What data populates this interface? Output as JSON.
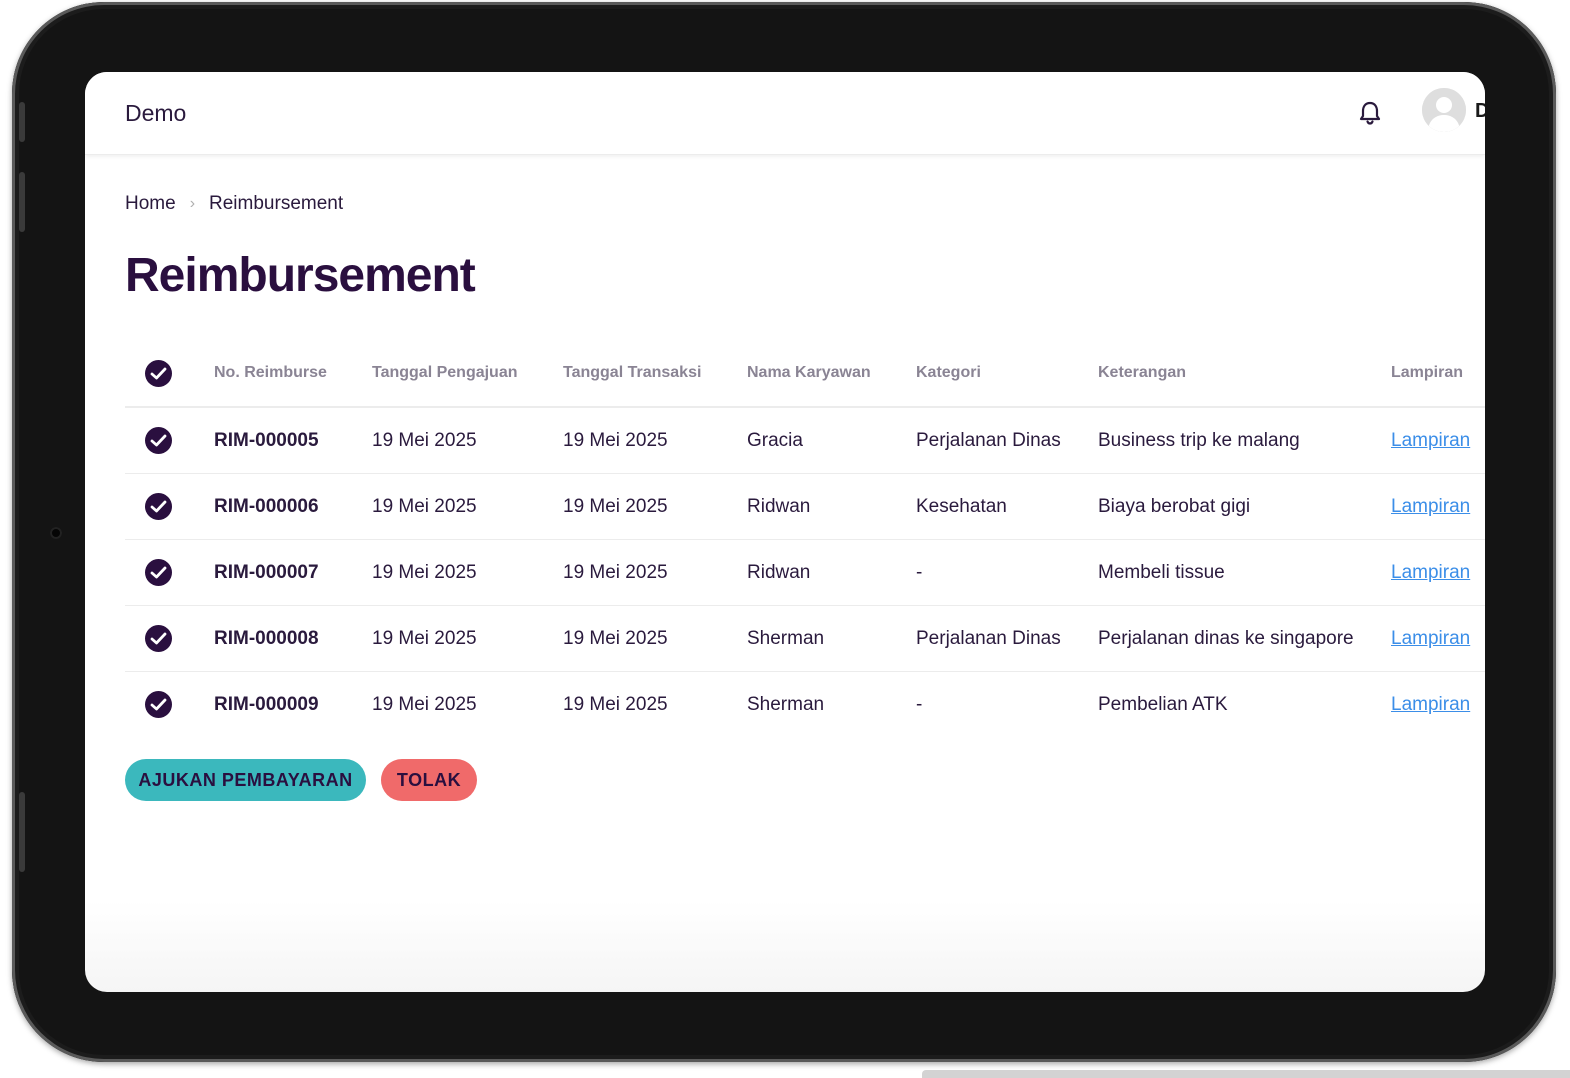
{
  "app": {
    "title": "Demo",
    "user_initial": "D"
  },
  "icons": {
    "notification": "bell-icon",
    "user": "user-avatar-icon",
    "breadcrumb_separator": "chevron-right-icon",
    "checkbox": "check-icon"
  },
  "colors": {
    "primary": "#2a0f3f",
    "submit_button": "#3bb8bd",
    "reject_button": "#f06a6a",
    "link": "#3b8ee8"
  },
  "breadcrumb": {
    "home": "Home",
    "current": "Reimbursement"
  },
  "page": {
    "title": "Reimbursement"
  },
  "table": {
    "headers": [
      "No. Reimburse",
      "Tanggal Pengajuan",
      "Tanggal Transaksi",
      "Nama Karyawan",
      "Kategori",
      "Keterangan",
      "Lampiran"
    ],
    "all_checked": true,
    "rows": [
      {
        "checked": true,
        "no": "RIM-000005",
        "tanggal_pengajuan": "19 Mei 2025",
        "tanggal_transaksi": "19 Mei 2025",
        "nama": "Gracia",
        "kategori": "Perjalanan Dinas",
        "keterangan": "Business trip ke malang",
        "lampiran": "Lampiran"
      },
      {
        "checked": true,
        "no": "RIM-000006",
        "tanggal_pengajuan": "19 Mei 2025",
        "tanggal_transaksi": "19 Mei 2025",
        "nama": "Ridwan",
        "kategori": "Kesehatan",
        "keterangan": "Biaya berobat gigi",
        "lampiran": "Lampiran"
      },
      {
        "checked": true,
        "no": "RIM-000007",
        "tanggal_pengajuan": "19 Mei 2025",
        "tanggal_transaksi": "19 Mei 2025",
        "nama": "Ridwan",
        "kategori": "-",
        "keterangan": "Membeli tissue",
        "lampiran": "Lampiran"
      },
      {
        "checked": true,
        "no": "RIM-000008",
        "tanggal_pengajuan": "19 Mei 2025",
        "tanggal_transaksi": "19 Mei 2025",
        "nama": "Sherman",
        "kategori": "Perjalanan Dinas",
        "keterangan": "Perjalanan dinas ke singapore",
        "lampiran": "Lampiran"
      },
      {
        "checked": true,
        "no": "RIM-000009",
        "tanggal_pengajuan": "19 Mei 2025",
        "tanggal_transaksi": "19 Mei 2025",
        "nama": "Sherman",
        "kategori": "-",
        "keterangan": "Pembelian ATK",
        "lampiran": "Lampiran"
      }
    ]
  },
  "actions": {
    "submit_label": "AJUKAN PEMBAYARAN",
    "reject_label": "TOLAK"
  }
}
